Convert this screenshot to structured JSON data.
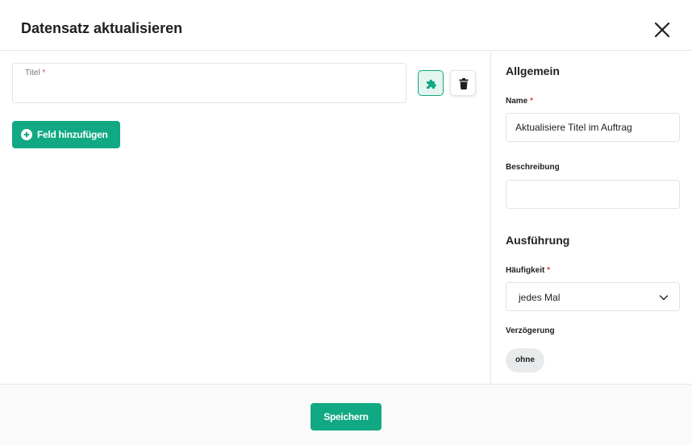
{
  "dialog": {
    "title": "Datensatz aktualisieren",
    "close_icon": "close-icon"
  },
  "main": {
    "field": {
      "label": "Titel",
      "required_mark": "*",
      "value": ""
    },
    "puzzle_icon": "puzzle-icon",
    "trash_icon": "trash-icon",
    "add_field_label": "Feld hinzufügen",
    "add_icon": "plus-circle-icon"
  },
  "sidebar": {
    "general_title": "Allgemein",
    "name_label": "Name",
    "name_required": "*",
    "name_value": "Aktualisiere Titel im Auftrag",
    "description_label": "Beschreibung",
    "description_value": "",
    "execution_title": "Ausführung",
    "frequency_label": "Häufigkeit",
    "frequency_required": "*",
    "frequency_value": "jedes Mal",
    "delay_label": "Verzögerung",
    "delay_value": "ohne"
  },
  "footer": {
    "save_label": "Speichern"
  },
  "colors": {
    "accent": "#11a983",
    "required": "#e0463f",
    "border": "#e3e3e3"
  }
}
